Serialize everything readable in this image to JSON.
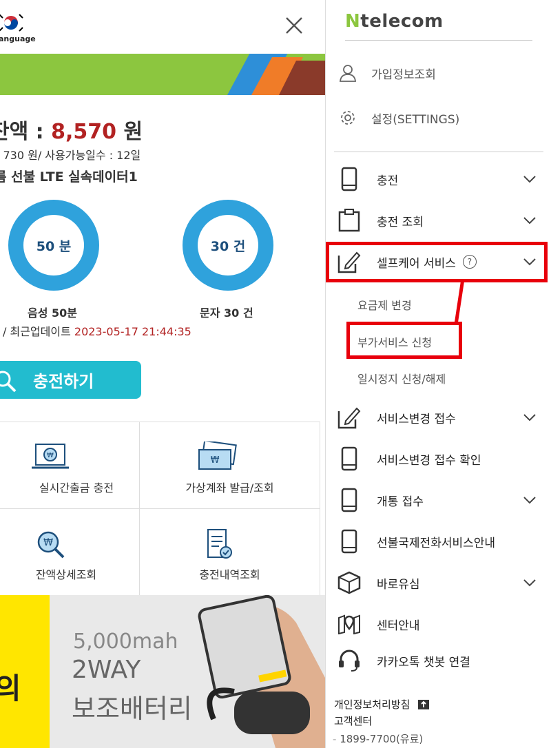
{
  "header": {
    "language_label": "anguage"
  },
  "balance": {
    "label": "잔액 : ",
    "amount": "8,570",
    "unit": " 원",
    "sub_line": ": 730 원/ 사용가능일수 : 12일",
    "plan_name": "름 선불 LTE 실속데이터1"
  },
  "usage": [
    {
      "ring_text": "50 분",
      "label": "음성 50분"
    },
    {
      "ring_text": "30 건",
      "label": "문자 30 건"
    }
  ],
  "update": {
    "prefix": "/ 최근업데이트 ",
    "datetime": "2023-05-17 21:44:35"
  },
  "charge_button": "충전하기",
  "grid_items": [
    {
      "label": "실시간출금 충전",
      "icon": "laptop-won-icon"
    },
    {
      "label": "가상계좌 발급/조회",
      "icon": "banknote-icon"
    },
    {
      "label": "잔액상세조회",
      "icon": "won-search-icon"
    },
    {
      "label": "충전내역조회",
      "icon": "receipt-check-icon"
    }
  ],
  "promo": {
    "left_char": "의",
    "line1": "5,000mah",
    "line2": "2WAY",
    "line3": "보조배터리"
  },
  "menu": {
    "logo_n": "N",
    "logo_rest": "telecom",
    "top_items": [
      "가입정보조회",
      "설정(SETTINGS)"
    ],
    "items": [
      {
        "label": "충전",
        "icon": "phone-icon",
        "chevron": true
      },
      {
        "label": "충전 조회",
        "icon": "clipboard-icon",
        "chevron": true
      },
      {
        "label": "셀프케어 서비스",
        "icon": "edit-icon",
        "chevron": true,
        "help": "?"
      },
      {
        "label": "서비스변경 접수",
        "icon": "edit-icon",
        "chevron": true
      },
      {
        "label": "서비스변경 접수 확인",
        "icon": "phone-icon",
        "chevron": false
      },
      {
        "label": "개통 접수",
        "icon": "phone-icon",
        "chevron": true
      },
      {
        "label": "선불국제전화서비스안내",
        "icon": "phone-icon",
        "chevron": false
      },
      {
        "label": "바로유심",
        "icon": "box-icon",
        "chevron": true
      },
      {
        "label": "센터안내",
        "icon": "map-pin-icon",
        "chevron": false
      },
      {
        "label": "카카오톡 챗봇 연결",
        "icon": "headset-icon",
        "chevron": false
      }
    ],
    "sub_items": [
      "요금제 변경",
      "부가서비스 신청",
      "일시정지 신청/해제"
    ],
    "footer": {
      "privacy": "개인정보처리방침",
      "support": "고객센터",
      "phone": "1899-7700",
      "phone_note": "(유료)"
    }
  },
  "colors": {
    "accent_green": "#8cc63f",
    "ring_blue": "#2fa2dc",
    "charge_teal": "#22bccf",
    "highlight_red": "#e8000b",
    "amount_red": "#b22222"
  }
}
